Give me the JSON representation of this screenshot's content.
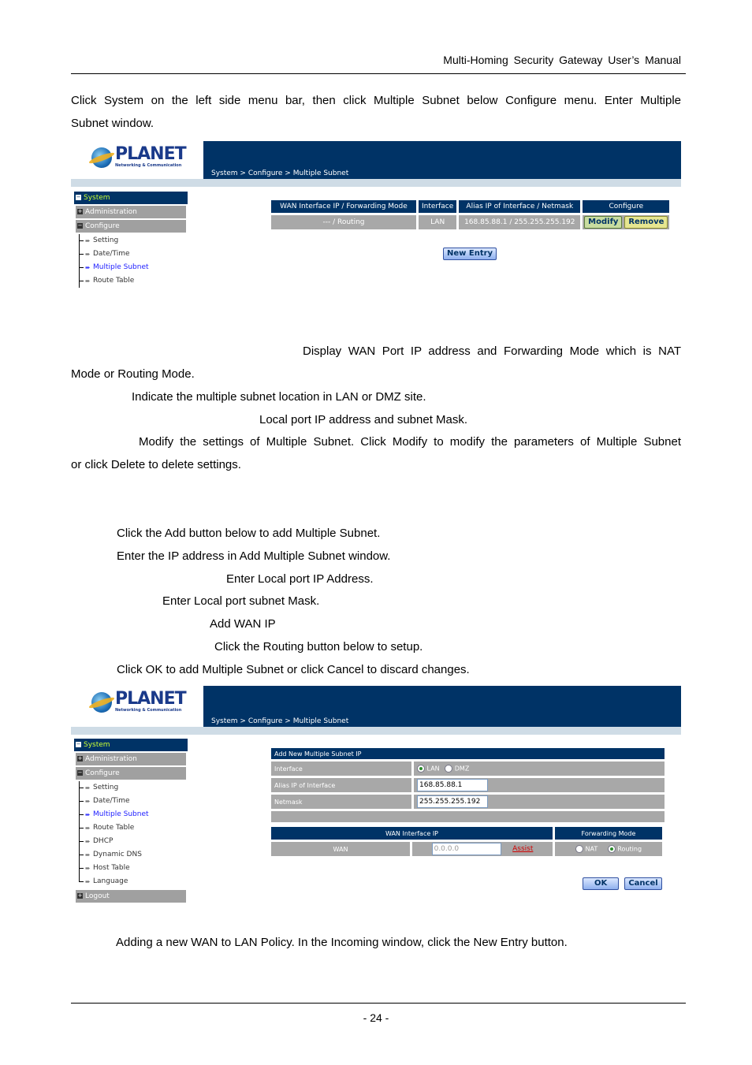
{
  "header": {
    "title": "Multi-Homing Security Gateway User’s Manual"
  },
  "intro": "Click System on the left side menu bar, then click Multiple Subnet below Configure menu. Enter Multiple Subnet window.",
  "intro_line1": "Click System on the left side menu bar, then click Multiple Subnet below Configure menu. Enter Multiple",
  "intro_line2": "Subnet window.",
  "shot1": {
    "logo": {
      "brand": "PLANET",
      "tagline": "Networking & Communication"
    },
    "breadcrumb": "System > Configure > Multiple Subnet",
    "menu": {
      "system": "System",
      "administration": "Administration",
      "configure": "Configure",
      "items": [
        "Setting",
        "Date/Time",
        "Multiple Subnet",
        "Route Table"
      ],
      "active": "Multiple Subnet"
    },
    "table": {
      "headers": [
        "WAN Interface IP / Forwarding Mode",
        "Interface",
        "Alias IP of Interface / Netmask",
        "Configure"
      ],
      "rows": [
        {
          "wan_mode": "--- / Routing",
          "interface": "LAN",
          "alias_netmask": "168.85.88.1 / 255.255.255.192",
          "modify": "Modify",
          "remove": "Remove"
        }
      ]
    },
    "new_entry": "New Entry"
  },
  "desc": {
    "line1": "Display WAN Port IP address and Forwarding Mode which is NAT",
    "line2": "Mode or Routing Mode.",
    "line3": "Indicate the multiple subnet location in LAN or DMZ site.",
    "line4": "Local port IP address and subnet Mask.",
    "line5": "Modify the settings of Multiple Subnet. Click Modify to modify the parameters of Multiple Subnet",
    "line6": "or click Delete to delete settings."
  },
  "steps": {
    "s1": "Click the Add button below to add Multiple Subnet.",
    "s2": "Enter the IP address in Add Multiple Subnet window.",
    "s3": "Enter Local port IP Address.",
    "s4": "Enter Local port subnet Mask.",
    "s5": "Add WAN IP",
    "s6": "Click the Routing button below to setup.",
    "s7": "Click OK to add Multiple Subnet or click Cancel to discard changes."
  },
  "shot2": {
    "logo": {
      "brand": "PLANET",
      "tagline": "Networking & Communication"
    },
    "breadcrumb": "System > Configure > Multiple Subnet",
    "menu": {
      "system": "System",
      "administration": "Administration",
      "configure": "Configure",
      "items": [
        "Setting",
        "Date/Time",
        "Multiple Subnet",
        "Route Table",
        "DHCP",
        "Dynamic DNS",
        "Host Table",
        "Language"
      ],
      "active": "Multiple Subnet",
      "logout": "Logout"
    },
    "form": {
      "title": "Add New Multiple Subnet IP",
      "interface_label": "Interface",
      "interface_options": [
        "LAN",
        "DMZ"
      ],
      "interface_selected": "LAN",
      "alias_label": "Alias IP of Interface",
      "alias_value": "168.85.88.1",
      "netmask_label": "Netmask",
      "netmask_value": "255.255.255.192",
      "wan_header": "WAN Interface IP",
      "mode_header": "Forwarding Mode",
      "wan_label": "WAN",
      "wan_value": "0.0.0.0",
      "assist": "Assist",
      "mode_options": [
        "NAT",
        "Routing"
      ],
      "mode_selected": "Routing",
      "ok": "OK",
      "cancel": "Cancel"
    }
  },
  "closing": "Adding a new WAN to LAN Policy. In the Incoming window, click the New Entry button.",
  "footer": {
    "page": "- 24 -"
  }
}
